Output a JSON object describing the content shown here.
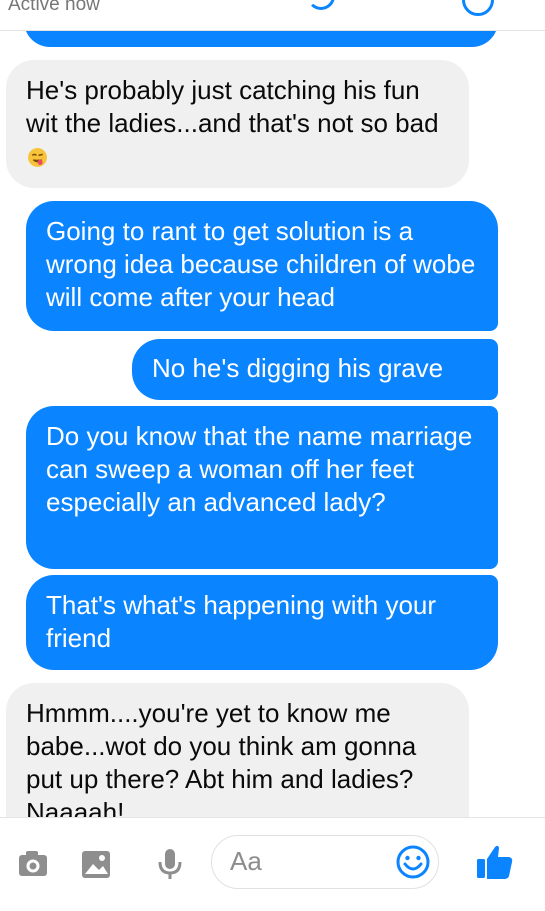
{
  "header": {
    "status": "Active now"
  },
  "conversation": {
    "messages": [
      {
        "direction": "outgoing",
        "text": ""
      },
      {
        "direction": "incoming",
        "text": "He's probably just catching his fun wit the ladies...and that's not so bad"
      },
      {
        "direction": "outgoing",
        "text": "Going to rant to get solution is a wrong idea because children of wobe will come after your head"
      },
      {
        "direction": "outgoing",
        "text": "No he's digging his grave"
      },
      {
        "direction": "outgoing",
        "text": "Do you know that the name marriage can sweep a woman off her feet especially an advanced lady?"
      },
      {
        "direction": "outgoing",
        "text": "That's what's happening with your friend"
      },
      {
        "direction": "incoming",
        "text": "Hmmm....you're yet to know me babe...wot do you think am gonna put up there? Abt him and ladies? Naaaah!"
      }
    ]
  },
  "composer": {
    "placeholder": "Aa",
    "icons": {
      "camera": "camera-icon",
      "gallery": "image-gallery-icon",
      "microphone": "microphone-icon",
      "emoji": "smiley-icon",
      "like": "thumbs-up-icon"
    }
  },
  "colors": {
    "accent": "#0a84ff",
    "incoming_bubble": "#f0f0f0",
    "icon_gray": "#8e8e8e"
  }
}
